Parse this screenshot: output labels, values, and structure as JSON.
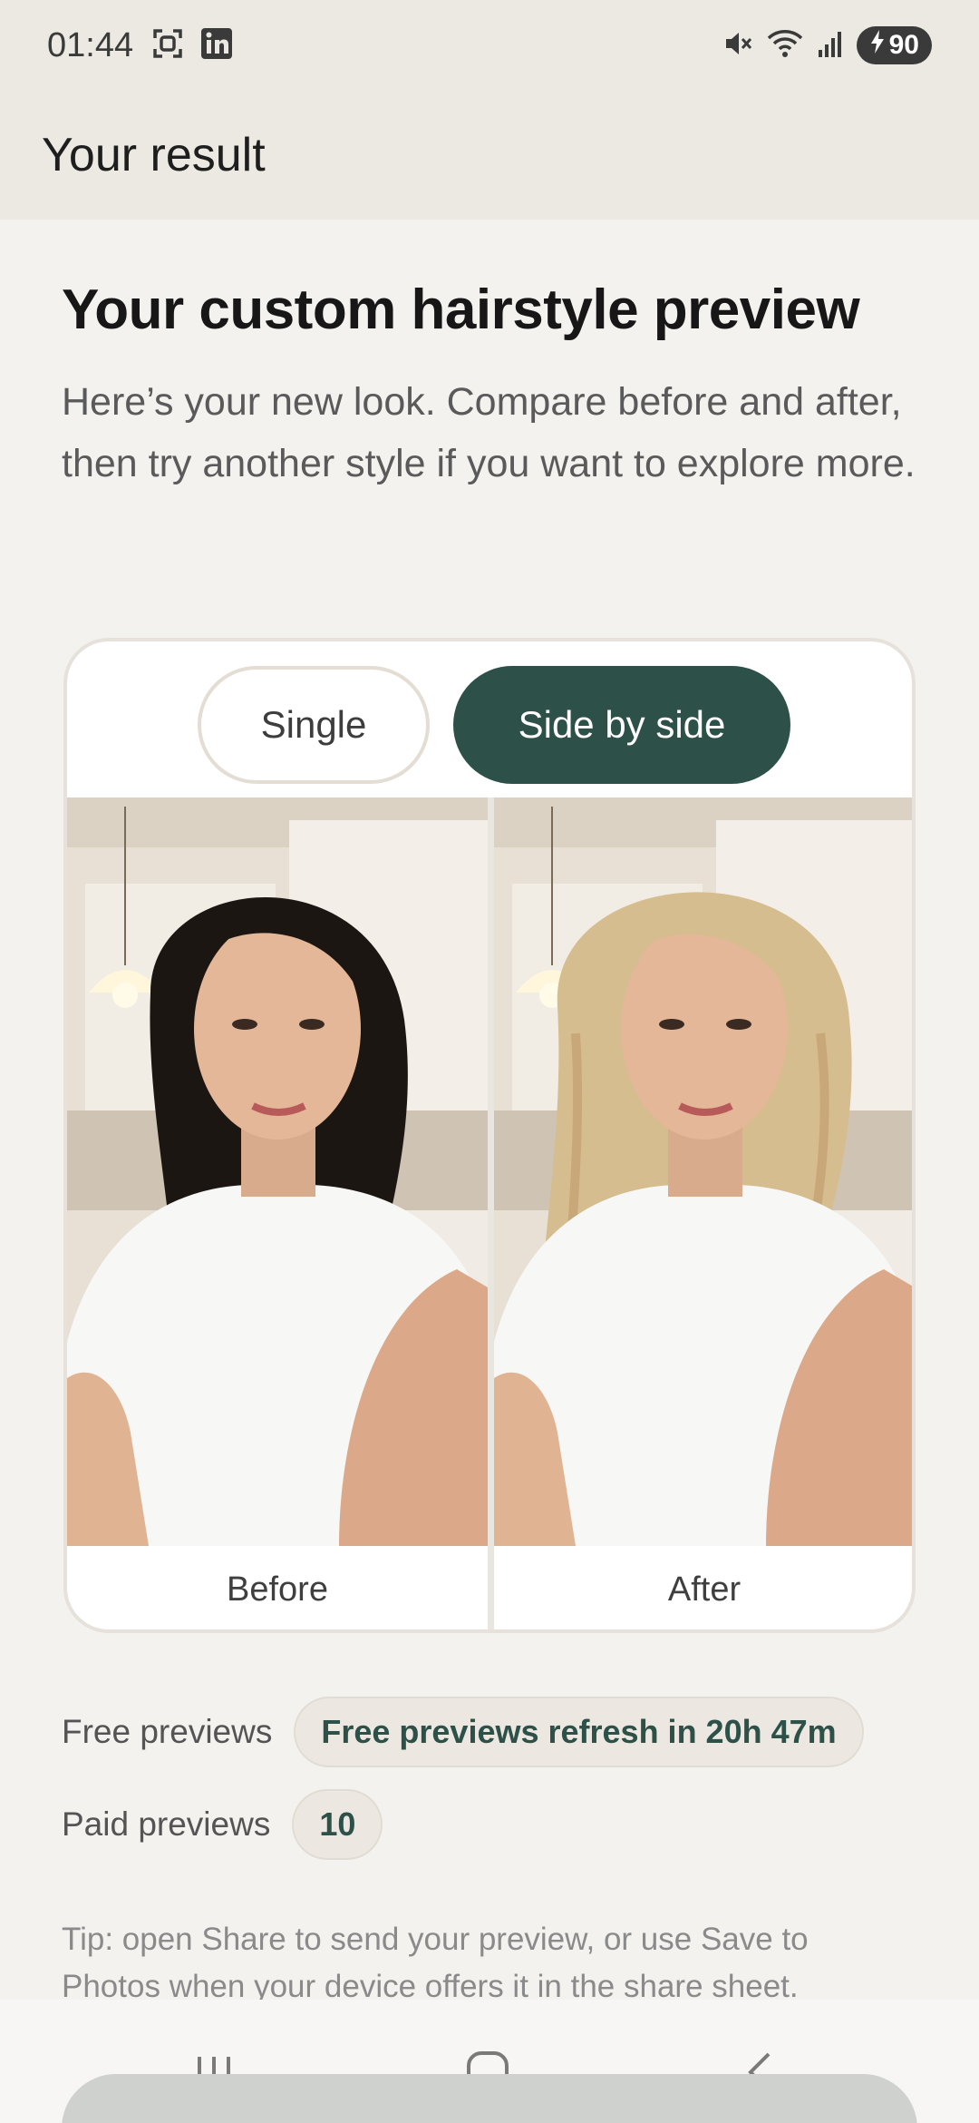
{
  "status_bar": {
    "time": "01:44",
    "battery": "90",
    "left_icons": [
      "screenshot-icon",
      "linkedin-icon"
    ],
    "right_icons": [
      "mute-icon",
      "wifi-icon",
      "signal-icon",
      "battery-charging-icon"
    ]
  },
  "app_bar": {
    "title": "Your result"
  },
  "page": {
    "title": "Your custom hairstyle preview",
    "description": "Here’s your new look. Compare before and after, then try another style if you want to explore more."
  },
  "compare": {
    "toggle_single": "Single",
    "toggle_side_by_side": "Side by side",
    "selected_mode": "Side by side",
    "before_label": "Before",
    "after_label": "After"
  },
  "quota": {
    "free_label": "Free previews",
    "free_value": "Free previews refresh in 20h 47m",
    "paid_label": "Paid previews",
    "paid_value": "10"
  },
  "tip": "Tip: open Share to send your preview, or use Save to Photos when your device offers it in the share sheet.",
  "nav": {
    "icons": [
      "recents-icon",
      "home-icon",
      "back-icon"
    ]
  },
  "colors": {
    "accent": "#2d5048",
    "background": "#f4f2ef",
    "header": "#ece8e2"
  }
}
